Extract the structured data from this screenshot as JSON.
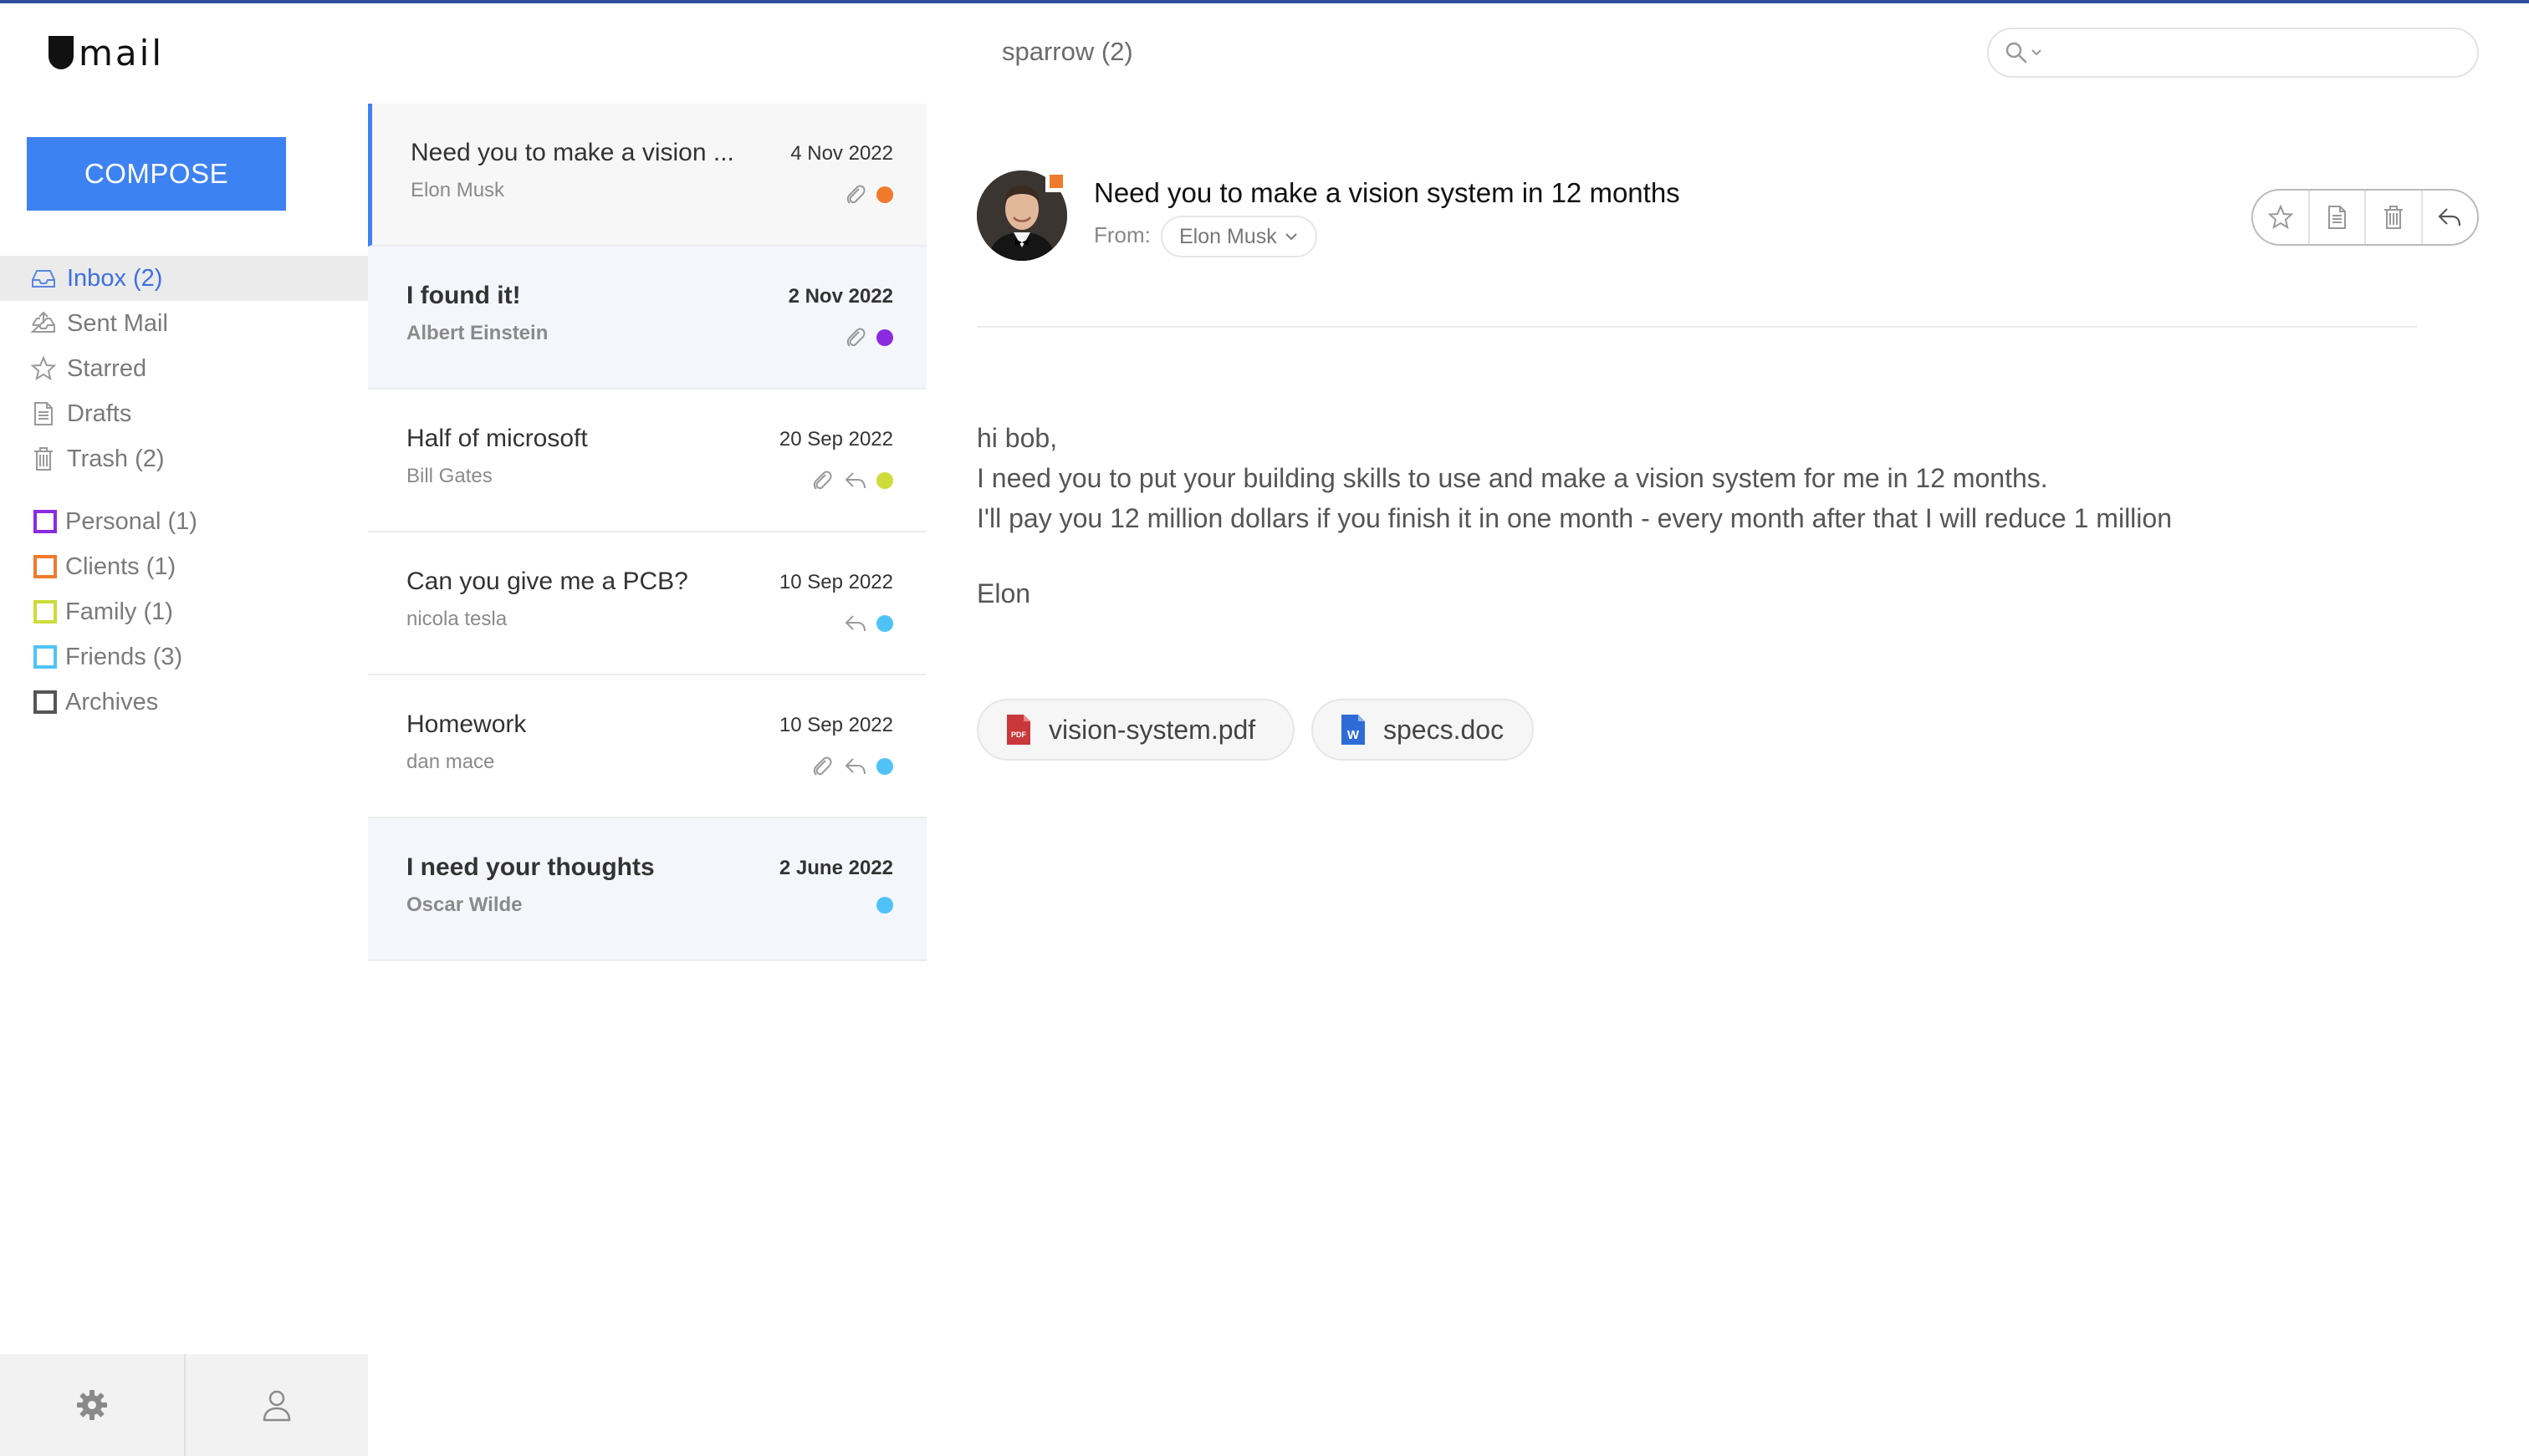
{
  "app": {
    "logo_text": "mail",
    "folder_title": "sparrow (2)",
    "search_placeholder": ""
  },
  "sidebar": {
    "compose_label": "COMPOSE",
    "items": [
      {
        "label": "Inbox (2)",
        "icon": "inbox-icon",
        "active": true
      },
      {
        "label": "Sent Mail",
        "icon": "sent-icon",
        "active": false
      },
      {
        "label": "Starred",
        "icon": "star-icon",
        "active": false
      },
      {
        "label": "Drafts",
        "icon": "draft-icon",
        "active": false
      },
      {
        "label": "Trash (2)",
        "icon": "trash-icon",
        "active": false
      }
    ],
    "labels": [
      {
        "label": "Personal (1)",
        "color": "#8a2be2"
      },
      {
        "label": "Clients (1)",
        "color": "#f07a2c"
      },
      {
        "label": "Family (1)",
        "color": "#cddc39"
      },
      {
        "label": "Friends (3)",
        "color": "#4fc3f7"
      },
      {
        "label": "Archives",
        "color": "#555555"
      }
    ],
    "footer": [
      "settings-icon",
      "user-icon"
    ]
  },
  "messages": [
    {
      "subject": "Need you to make a vision ...",
      "from": "Elon Musk",
      "date": "4 Nov 2022",
      "attachment": true,
      "replied": false,
      "dot_color": "#f07a2c",
      "selected": true,
      "unread": false
    },
    {
      "subject": "I found it!",
      "from": "Albert Einstein",
      "date": "2 Nov 2022",
      "attachment": true,
      "replied": false,
      "dot_color": "#8a2be2",
      "selected": false,
      "unread": true
    },
    {
      "subject": "Half of microsoft",
      "from": "Bill Gates",
      "date": "20 Sep 2022",
      "attachment": true,
      "replied": true,
      "dot_color": "#cddc39",
      "selected": false,
      "unread": false
    },
    {
      "subject": "Can you give me a PCB?",
      "from": "nicola tesla",
      "date": "10 Sep 2022",
      "attachment": false,
      "replied": true,
      "dot_color": "#4fc3f7",
      "selected": false,
      "unread": false
    },
    {
      "subject": "Homework",
      "from": "dan mace",
      "date": "10 Sep 2022",
      "attachment": true,
      "replied": true,
      "dot_color": "#4fc3f7",
      "selected": false,
      "unread": false
    },
    {
      "subject": "I need your thoughts",
      "from": "Oscar Wilde",
      "date": "2 June 2022",
      "attachment": false,
      "replied": false,
      "dot_color": "#4fc3f7",
      "selected": false,
      "unread": true
    }
  ],
  "reading": {
    "subject": "Need you to make a vision system in 12 months",
    "from_label": "From:",
    "from_name": "Elon Musk",
    "body_lines": [
      "hi bob,",
      "I need you to put your building skills to use and make a vision system for me in 12 months.",
      "I'll pay you 12 million dollars if you finish it in one month - every month after that I will reduce 1 million"
    ],
    "signature": "Elon",
    "attachments": [
      {
        "name": "vision-system.pdf",
        "type": "pdf"
      },
      {
        "name": "specs.doc",
        "type": "doc"
      }
    ],
    "badge_color": "#f07a2c"
  }
}
